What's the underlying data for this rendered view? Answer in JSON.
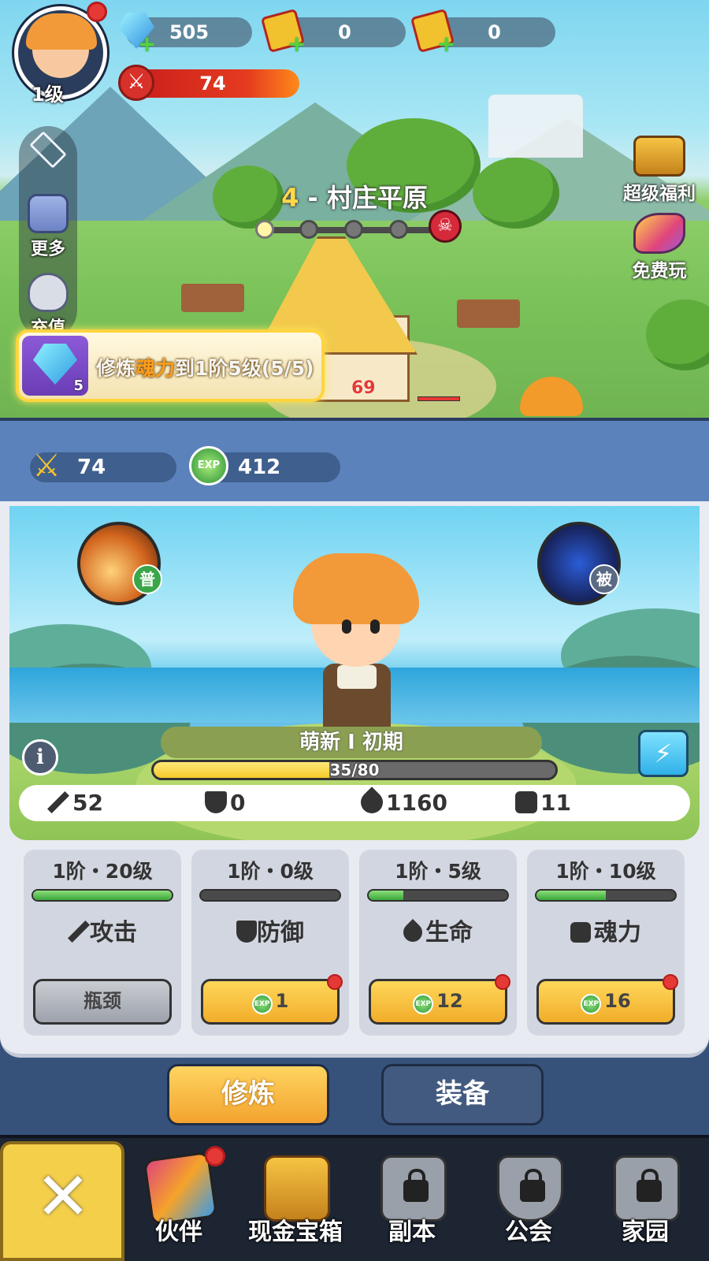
{
  "player": {
    "level": "1级"
  },
  "resources": [
    {
      "icon": "gem-icon",
      "value": "505"
    },
    {
      "icon": "ticket-icon",
      "value": "0"
    },
    {
      "icon": "timed-ticket-icon",
      "value": "0"
    }
  ],
  "power": "74",
  "side_menu": [
    {
      "icon": "diamond-chevron-icon",
      "label": ""
    },
    {
      "icon": "more-icon",
      "label": "更多"
    },
    {
      "icon": "money-bag-icon",
      "label": "充值"
    }
  ],
  "stage": {
    "number": "4",
    "name": "- 村庄平原",
    "progress_done": 1,
    "progress_total": 5
  },
  "right_buttons": [
    {
      "icon": "treasure-chest-icon",
      "label": "超级福利"
    },
    {
      "icon": "free-play-icon",
      "label": "免费玩"
    }
  ],
  "quest": {
    "count": "5",
    "text_prefix": "修炼",
    "text_highlight": "魂力",
    "text_suffix": "到1阶5级(5/5)"
  },
  "enemy_hp": "69",
  "stats_strip": {
    "power": "74",
    "exp": "412"
  },
  "hero": {
    "rank": "萌新 I  初期",
    "exp_text": "35/80",
    "exp_current": 35,
    "exp_max": 80,
    "skill_normal_badge": "普",
    "skill_passive_badge": "被"
  },
  "attributes": [
    {
      "icon": "sword-icon",
      "value": "52"
    },
    {
      "icon": "shield-icon",
      "value": "0"
    },
    {
      "icon": "drop-icon",
      "value": "1160"
    },
    {
      "icon": "fist-icon",
      "value": "11"
    }
  ],
  "cards": [
    {
      "level": "1阶・20级",
      "progress": 1.0,
      "icon": "sword-icon",
      "name": "攻击",
      "button": "瓶颈",
      "button_type": "gray",
      "cost": "",
      "has_dot": false
    },
    {
      "level": "1阶・0级",
      "progress": 0.0,
      "icon": "shield-icon",
      "name": "防御",
      "button": "",
      "button_type": "gold",
      "cost": "1",
      "has_dot": true
    },
    {
      "level": "1阶・5级",
      "progress": 0.25,
      "icon": "drop-icon",
      "name": "生命",
      "button": "",
      "button_type": "gold",
      "cost": "12",
      "has_dot": true
    },
    {
      "level": "1阶・10级",
      "progress": 0.5,
      "icon": "fist-icon",
      "name": "魂力",
      "button": "",
      "button_type": "gold",
      "cost": "16",
      "has_dot": true
    }
  ],
  "tabs": {
    "train": "修炼",
    "equip": "装备"
  },
  "nav": [
    {
      "icon": "cards-icon",
      "label": "伙伴",
      "locked": false
    },
    {
      "icon": "cash-chest-icon",
      "label": "现金宝箱",
      "locked": false
    },
    {
      "icon": "dungeon-icon",
      "label": "副本",
      "locked": true
    },
    {
      "icon": "guild-icon",
      "label": "公会",
      "locked": true
    },
    {
      "icon": "home-icon",
      "label": "家园",
      "locked": true
    }
  ],
  "exp_coin_label": "EXP",
  "colors": {
    "accent_gold": "#f3a32f",
    "hp_red": "#e53935",
    "panel_blue": "#5b82bb"
  }
}
